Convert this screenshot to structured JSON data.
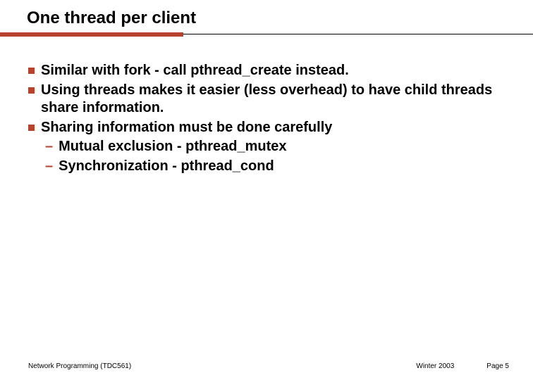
{
  "title": "One thread per client",
  "bullets": {
    "b0": "Similar with fork - call pthread_create instead.",
    "b1": "Using threads makes it easier (less overhead) to have child threads share information.",
    "b2": "Sharing information must be done carefully",
    "b2_sub0": "Mutual exclusion - pthread_mutex",
    "b2_sub1": "Synchronization - pthread_cond"
  },
  "footer": {
    "left": "Network Programming (TDC561)",
    "term": "Winter 2003",
    "page": "Page 5"
  }
}
